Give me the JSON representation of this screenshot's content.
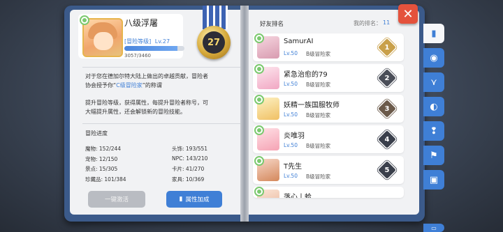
{
  "header": {
    "close_label": "✕"
  },
  "profile": {
    "name": "八级浮屠",
    "rank_label": "[冒险等级]",
    "level": "Lv.27",
    "exp_text": "3057/3460",
    "exp_progress": 0.88,
    "medal_number": "27"
  },
  "description": {
    "line1": "对于您在德加尔特大陆上做出的卓越贡献，冒险者",
    "line2_pre": "协会授予你“",
    "line2_highlight": "C级冒险家",
    "line2_post": "”的称谓",
    "line3": "提升冒险等级，获得属性，每提升冒险者称号，可",
    "line4": "大幅提升属性，还会解锁新的冒险技能。"
  },
  "progress": {
    "title": "冒险进度",
    "stats": [
      {
        "label": "魔物: 152/244"
      },
      {
        "label": "头饰: 193/551"
      },
      {
        "label": "宠物: 12/150"
      },
      {
        "label": "NPC: 143/210"
      },
      {
        "label": "景点: 15/305"
      },
      {
        "label": "卡片: 41/270"
      },
      {
        "label": "珍藏品: 101/384"
      },
      {
        "label": "家具: 10/369"
      }
    ]
  },
  "buttons": {
    "activate": "一键激活",
    "attributes": "属性加成"
  },
  "ranking": {
    "title": "好友排名",
    "my_rank_label": "我的排名：",
    "my_rank_value": "11",
    "rows": [
      {
        "name": "SamurAI",
        "level": "Lv.50",
        "class": "B级冒险家",
        "rank": "1"
      },
      {
        "name": "紧急治愈的79",
        "level": "Lv.50",
        "class": "B级冒险家",
        "rank": "2"
      },
      {
        "name": "妖精一族国服牧师",
        "level": "Lv.50",
        "class": "B级冒险家",
        "rank": "3"
      },
      {
        "name": "炎唯羽",
        "level": "Lv.50",
        "class": "B级冒险家",
        "rank": "4"
      },
      {
        "name": "T先生",
        "level": "Lv.50",
        "class": "B级冒险家",
        "rank": "5"
      },
      {
        "name": "落心丨蛤",
        "level": "",
        "class": "",
        "rank": ""
      }
    ]
  },
  "side_tabs": [
    {
      "icon": "book-icon"
    },
    {
      "icon": "monster-icon"
    },
    {
      "icon": "horns-icon"
    },
    {
      "icon": "pet-icon"
    },
    {
      "icon": "npc-icon"
    },
    {
      "icon": "map-icon"
    },
    {
      "icon": "card-icon"
    },
    {
      "icon": "chest-icon"
    }
  ],
  "colors": {
    "accent": "#3f7fd6",
    "close": "#e4523c",
    "gold": "#d6a93a"
  }
}
